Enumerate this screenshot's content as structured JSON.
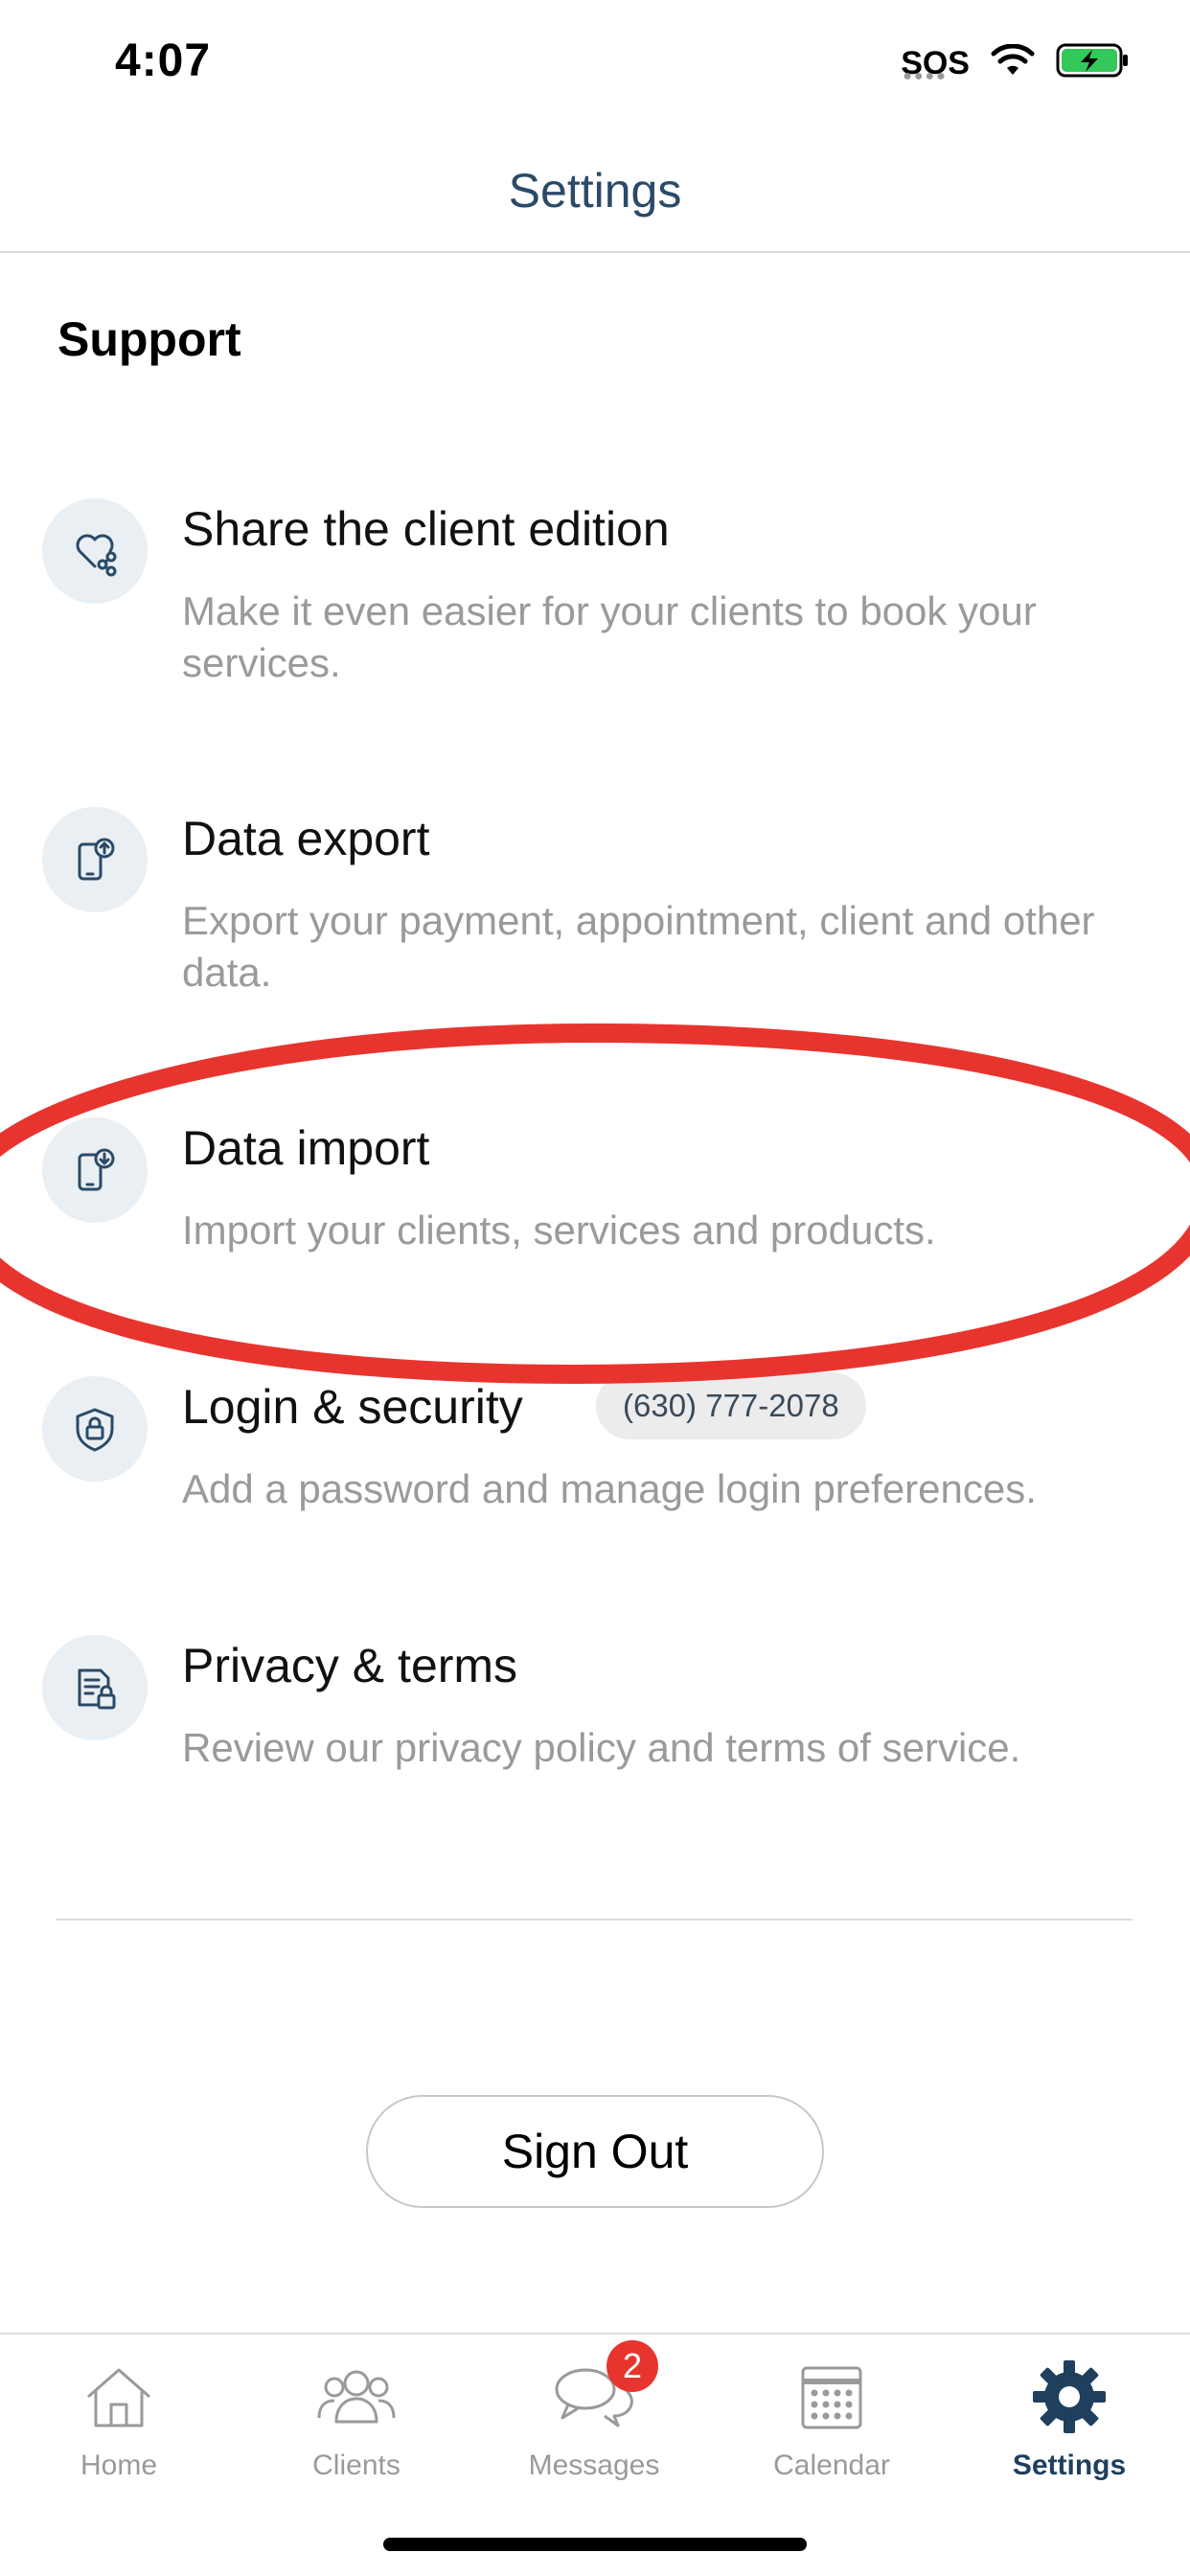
{
  "status_bar": {
    "time": "4:07",
    "sos_label": "SOS",
    "icons": [
      "wifi-icon",
      "battery-charging-icon"
    ]
  },
  "header": {
    "title": "Settings"
  },
  "section": {
    "title": "Support"
  },
  "items": [
    {
      "icon": "heart-share-icon",
      "title": "Share the client edition",
      "description": "Make it even easier for your clients to book your services."
    },
    {
      "icon": "phone-upload-icon",
      "title": "Data export",
      "description": "Export your payment, appointment, client and other data."
    },
    {
      "icon": "phone-download-icon",
      "title": "Data import",
      "description": "Import your clients, services and products."
    },
    {
      "icon": "shield-lock-icon",
      "title": "Login & security",
      "badge": "(630) 777-2078",
      "description": "Add a password and manage login preferences."
    },
    {
      "icon": "document-lock-icon",
      "title": "Privacy & terms",
      "description": "Review our privacy policy and terms of service."
    }
  ],
  "sign_out_label": "Sign Out",
  "tabs": [
    {
      "label": "Home",
      "icon": "home-icon",
      "active": false
    },
    {
      "label": "Clients",
      "icon": "users-icon",
      "active": false
    },
    {
      "label": "Messages",
      "icon": "chat-icon",
      "active": false,
      "badge": "2"
    },
    {
      "label": "Calendar",
      "icon": "calendar-icon",
      "active": false
    },
    {
      "label": "Settings",
      "icon": "gear-icon",
      "active": true
    }
  ],
  "colors": {
    "accent": "#1f3f5e",
    "header_title": "#2a4a68",
    "secondary_text": "#9a9a9a",
    "icon_circle": "#eaeff3",
    "annotation": "#e8342e",
    "badge": "#e8342e"
  }
}
